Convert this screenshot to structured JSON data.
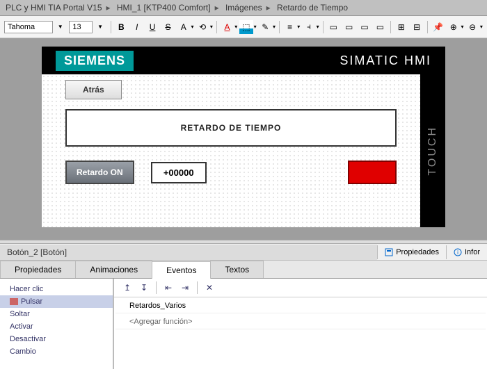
{
  "breadcrumb": [
    "PLC y HMI TIA Portal V15",
    "HMI_1 [KTP400 Comfort]",
    "Imágenes",
    "Retardo de Tiempo"
  ],
  "toolbar": {
    "font": "Tahoma",
    "size": "13"
  },
  "device": {
    "brand": "SIEMENS",
    "product": "SIMATIC HMI",
    "side": "TOUCH"
  },
  "screen": {
    "back_btn": "Atrás",
    "title": "RETARDO DE TIEMPO",
    "retardo_btn": "Retardo ON",
    "io_value": "+00000"
  },
  "inspector": {
    "object": "Botón_2 [Botón]",
    "btn_props": "Propiedades",
    "btn_info": "Infor"
  },
  "tabs": {
    "t1": "Propiedades",
    "t2": "Animaciones",
    "t3": "Eventos",
    "t4": "Textos"
  },
  "events": {
    "list": {
      "e1": "Hacer clic",
      "e2": "Pulsar",
      "e3": "Soltar",
      "e4": "Activar",
      "e5": "Desactivar",
      "e6": "Cambio"
    },
    "func1": "Retardos_Varios",
    "add": "<Agregar función>"
  }
}
